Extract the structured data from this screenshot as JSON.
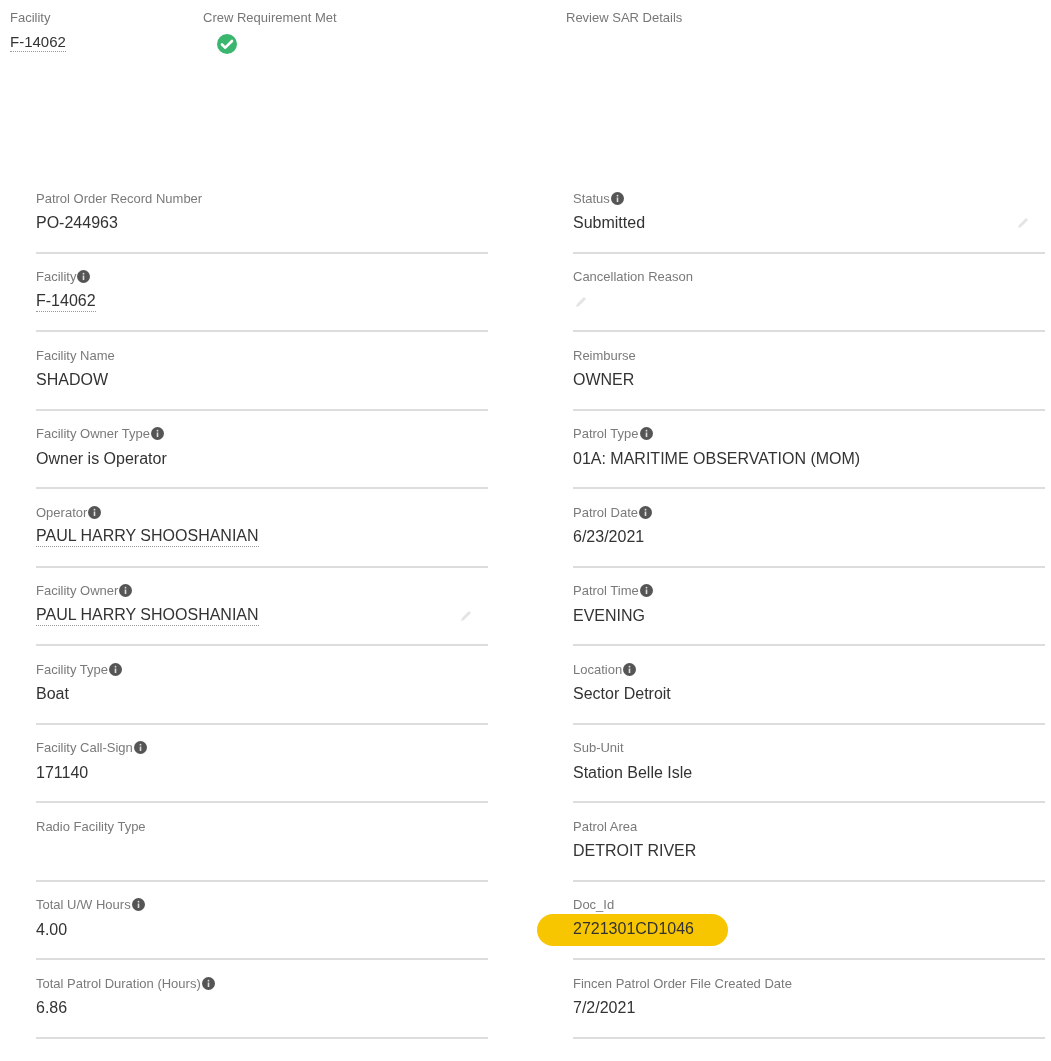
{
  "header": [
    {
      "label": "Facility",
      "kind": "link",
      "value": "F-14062"
    },
    {
      "label": "Crew Requirement Met",
      "kind": "check",
      "checked": true
    },
    {
      "label": "Review SAR Details",
      "kind": "text"
    }
  ],
  "fields": [
    {
      "label": "Patrol Order Record Number",
      "value": "PO-244963"
    },
    {
      "label": "Status",
      "value": "Submitted",
      "info": true,
      "editable": true
    },
    {
      "label": "Facility",
      "value": "F-14062",
      "info": true,
      "link": true
    },
    {
      "label": "Cancellation Reason",
      "editable": true
    },
    {
      "label": "Facility Name",
      "value": "SHADOW"
    },
    {
      "label": "Reimburse",
      "value": "OWNER"
    },
    {
      "label": "Facility Owner Type",
      "value": "Owner is Operator",
      "info": true
    },
    {
      "label": "Patrol Type",
      "value": "01A: MARITIME OBSERVATION (MOM)",
      "info": true
    },
    {
      "label": "Operator",
      "value": "PAUL HARRY SHOOSHANIAN",
      "info": true,
      "link": true
    },
    {
      "label": "Patrol Date",
      "value": "6/23/2021",
      "info": true
    },
    {
      "label": "Facility Owner",
      "value": "PAUL HARRY SHOOSHANIAN",
      "info": true,
      "editable": true,
      "link": true
    },
    {
      "label": "Patrol Time",
      "value": "EVENING",
      "info": true
    },
    {
      "label": "Facility Type",
      "value": "Boat",
      "info": true
    },
    {
      "label": "Location",
      "value": "Sector Detroit",
      "info": true
    },
    {
      "label": "Facility Call-Sign",
      "value": "171140",
      "info": true
    },
    {
      "label": "Sub-Unit",
      "value": "Station Belle Isle"
    },
    {
      "label": "Radio Facility Type"
    },
    {
      "label": "Patrol Area",
      "value": "DETROIT RIVER"
    },
    {
      "label": "Total U/W Hours",
      "value": "4.00",
      "info": true
    },
    {
      "label": "Doc_Id",
      "value": "2721301CD1046",
      "highlighted": true
    },
    {
      "label": "Total Patrol Duration (Hours)",
      "value": "6.86",
      "info": true
    },
    {
      "label": "Fincen Patrol Order File Created Date",
      "value": "7/2/2021"
    }
  ]
}
